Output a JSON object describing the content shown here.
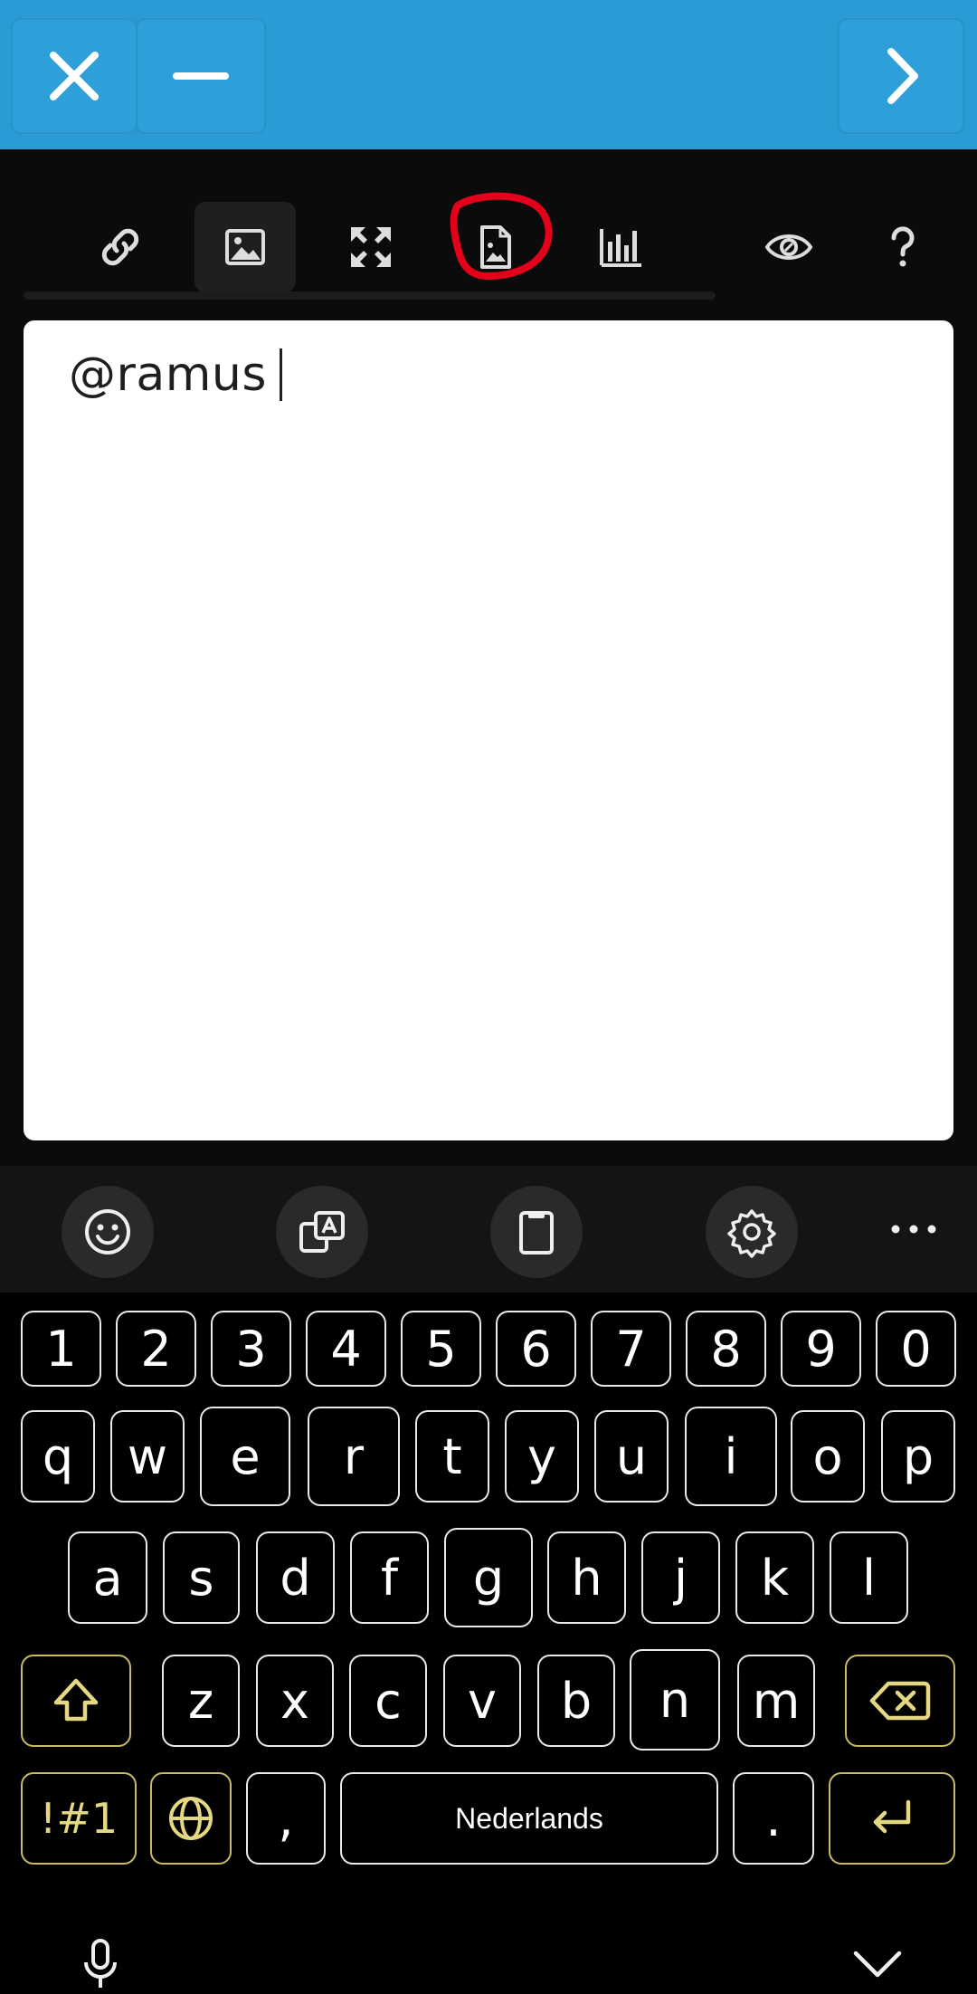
{
  "topbar": {
    "close_icon": "close-icon",
    "minimize_icon": "minus-icon",
    "next_icon": "chevron-right-icon",
    "color": "#2a9bd4"
  },
  "toolbar": {
    "tools": [
      "link-icon",
      "image-icon",
      "fullscreen-icon",
      "file-image-icon",
      "chart-icon",
      "preview-eye-icon",
      "help-icon"
    ],
    "selected": "image-icon",
    "annotation_color": "#e3001b"
  },
  "editor": {
    "text": "@ramus"
  },
  "keyboard_tools": [
    "emoji-icon",
    "translate-icon",
    "clipboard-icon",
    "settings-icon",
    "more-icon"
  ],
  "keyboard": {
    "number_row": [
      "1",
      "2",
      "3",
      "4",
      "5",
      "6",
      "7",
      "8",
      "9",
      "0"
    ],
    "row1": [
      "q",
      "w",
      "e",
      "r",
      "t",
      "y",
      "u",
      "i",
      "o",
      "p"
    ],
    "row2": [
      "a",
      "s",
      "d",
      "f",
      "g",
      "h",
      "j",
      "k",
      "l"
    ],
    "row3": [
      "z",
      "x",
      "c",
      "v",
      "b",
      "n",
      "m"
    ],
    "symbols_label": "!#1",
    "comma": ",",
    "space_label": "Nederlands",
    "period": ".",
    "accent_color": "#c9bb66"
  },
  "bottom": {
    "mic_icon": "microphone-icon",
    "hide_icon": "chevron-down-icon"
  }
}
